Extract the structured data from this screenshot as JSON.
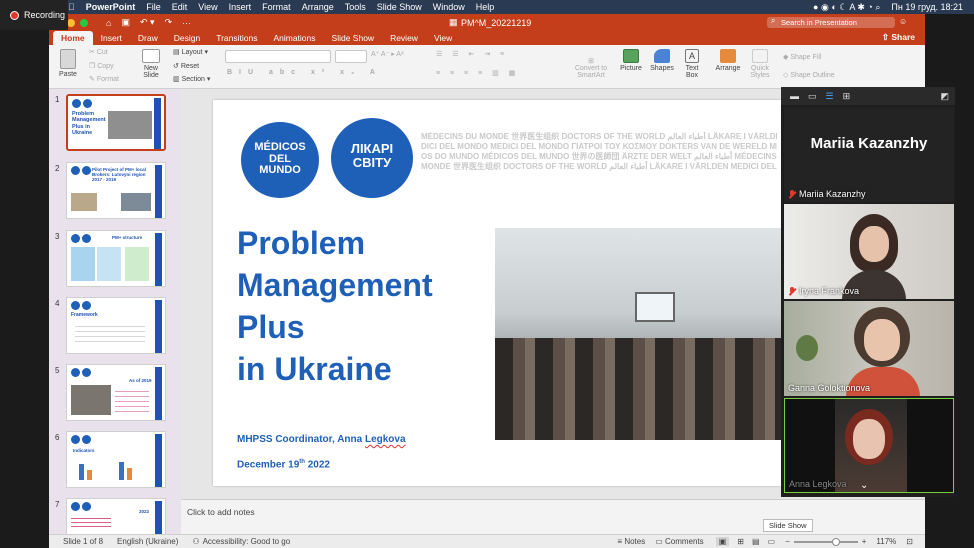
{
  "recording": {
    "label": "Recording"
  },
  "menubar": {
    "app": "PowerPoint",
    "items": [
      "File",
      "Edit",
      "View",
      "Insert",
      "Format",
      "Arrange",
      "Tools",
      "Slide Show",
      "Window",
      "Help"
    ],
    "clock": "Пн 19 груд.  18:21"
  },
  "window": {
    "title": "PM^M_20221219",
    "search_placeholder": "Search in Presentation",
    "share": "Share"
  },
  "tabs": [
    "Home",
    "Insert",
    "Draw",
    "Design",
    "Transitions",
    "Animations",
    "Slide Show",
    "Review",
    "View"
  ],
  "ribbon": {
    "paste": "Paste",
    "cut": "Cut",
    "copy": "Copy",
    "format": "Format",
    "new_slide": "New Slide",
    "layout": "Layout",
    "reset": "Reset",
    "section": "Section",
    "convert": "Convert to SmartArt",
    "picture": "Picture",
    "shapes": "Shapes",
    "text_box": "Text Box",
    "arrange": "Arrange",
    "quick_styles": "Quick Styles",
    "shape_fill": "Shape Fill",
    "shape_outline": "Shape Outline"
  },
  "thumbnails": [
    {
      "num": "1",
      "title": "Problem Management Plus in Ukraine",
      "selected": true
    },
    {
      "num": "2",
      "title": "Pilot Project of PM+ local Brokers: Lutovynі region 2017 - 2019"
    },
    {
      "num": "3",
      "title": "PM+ structure"
    },
    {
      "num": "4",
      "title": "Framework"
    },
    {
      "num": "5",
      "title": "As of 2019"
    },
    {
      "num": "6",
      "title": "Indicators"
    },
    {
      "num": "7",
      "title": "2022"
    }
  ],
  "slide": {
    "logo1": "MÉDICOS DEL MUNDO",
    "logo2": "ЛІКАРІ СВІТУ",
    "tagline": [
      "MÉDECINS DU MONDE 世界医生组织 DOCTORS OF THE WORLD أطباء العالم LÄKARE I VÄRLDEN M",
      "DICI DEL MONDO MEDICI DEL MONDO ΓΙΑΤΡΟΙ ΤΟΥ ΚΟΣΜΟΥ DOKTERS VAN DE WERELD MÉ",
      "OS DO MUNDO MÉDICOS DEL MUNDO 世界の医師団 ÄRZTE DER WELT أطباء العالم MÉDECINS D",
      "MONDE 世界医生组织 DOCTORS OF THE WORLD أطباء العالم LÄKARE I VÄRLDEN MEDICI DEL MO"
    ],
    "title_lines": [
      "Problem",
      "Management",
      "Plus",
      "in Ukraine"
    ],
    "coordinator_prefix": "MHPSS Coordinator, Anna ",
    "coordinator_name": "Legkova",
    "date_pre": "December 19",
    "date_sup": "th",
    "date_post": "  2022"
  },
  "notes": {
    "placeholder": "Click to add notes"
  },
  "status": {
    "slide": "Slide 1 of 8",
    "lang": "English (Ukraine)",
    "accessibility": "Accessibility: Good to go",
    "notes": "Notes",
    "comments": "Comments",
    "zoom": "117%"
  },
  "tooltip": "Slide Show",
  "zoom_panel": {
    "speaker": "Mariia Kazanzhy",
    "participants": [
      {
        "name": "Mariia Kazanzhy",
        "muted": true
      },
      {
        "name": "Iryna Frankova",
        "muted": true
      },
      {
        "name": "Ganna Goloktionova",
        "muted": false
      },
      {
        "name": "Anna Legkova",
        "muted": false
      }
    ]
  }
}
